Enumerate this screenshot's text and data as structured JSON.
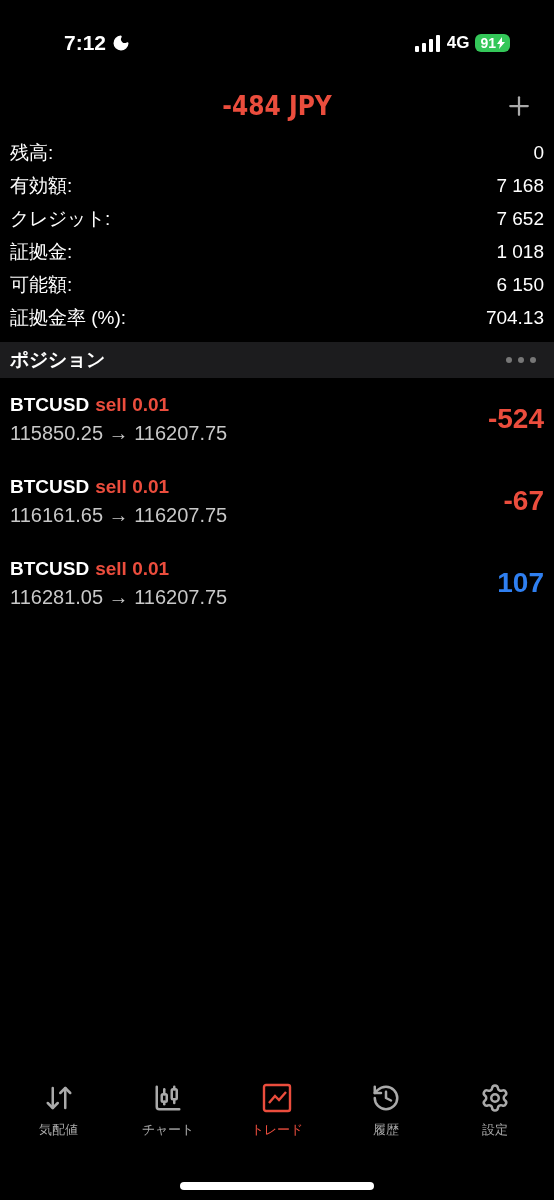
{
  "status_bar": {
    "time": "7:12",
    "network": "4G",
    "battery": "91"
  },
  "header": {
    "title": "-484 JPY"
  },
  "account": [
    {
      "label": "残高:",
      "value": "0"
    },
    {
      "label": "有効額:",
      "value": "7 168"
    },
    {
      "label": "クレジット:",
      "value": "7 652"
    },
    {
      "label": "証拠金:",
      "value": "1 018"
    },
    {
      "label": "可能額:",
      "value": "6 150"
    },
    {
      "label": "証拠金率 (%):",
      "value": "704.13"
    }
  ],
  "section": {
    "title": "ポジション"
  },
  "positions": [
    {
      "symbol": "BTCUSD",
      "side": "sell 0.01",
      "prices": "115850.25 → 116207.75",
      "profit": "-524",
      "color": "#eb4d3d"
    },
    {
      "symbol": "BTCUSD",
      "side": "sell 0.01",
      "prices": "116161.65 → 116207.75",
      "profit": "-67",
      "color": "#eb4d3d"
    },
    {
      "symbol": "BTCUSD",
      "side": "sell 0.01",
      "prices": "116281.05 → 116207.75",
      "profit": "107",
      "color": "#2f7ff0"
    }
  ],
  "tabs": [
    {
      "label": "気配値",
      "selected": false
    },
    {
      "label": "チャート",
      "selected": false
    },
    {
      "label": "トレード",
      "selected": true
    },
    {
      "label": "履歴",
      "selected": false
    },
    {
      "label": "設定",
      "selected": false
    }
  ]
}
